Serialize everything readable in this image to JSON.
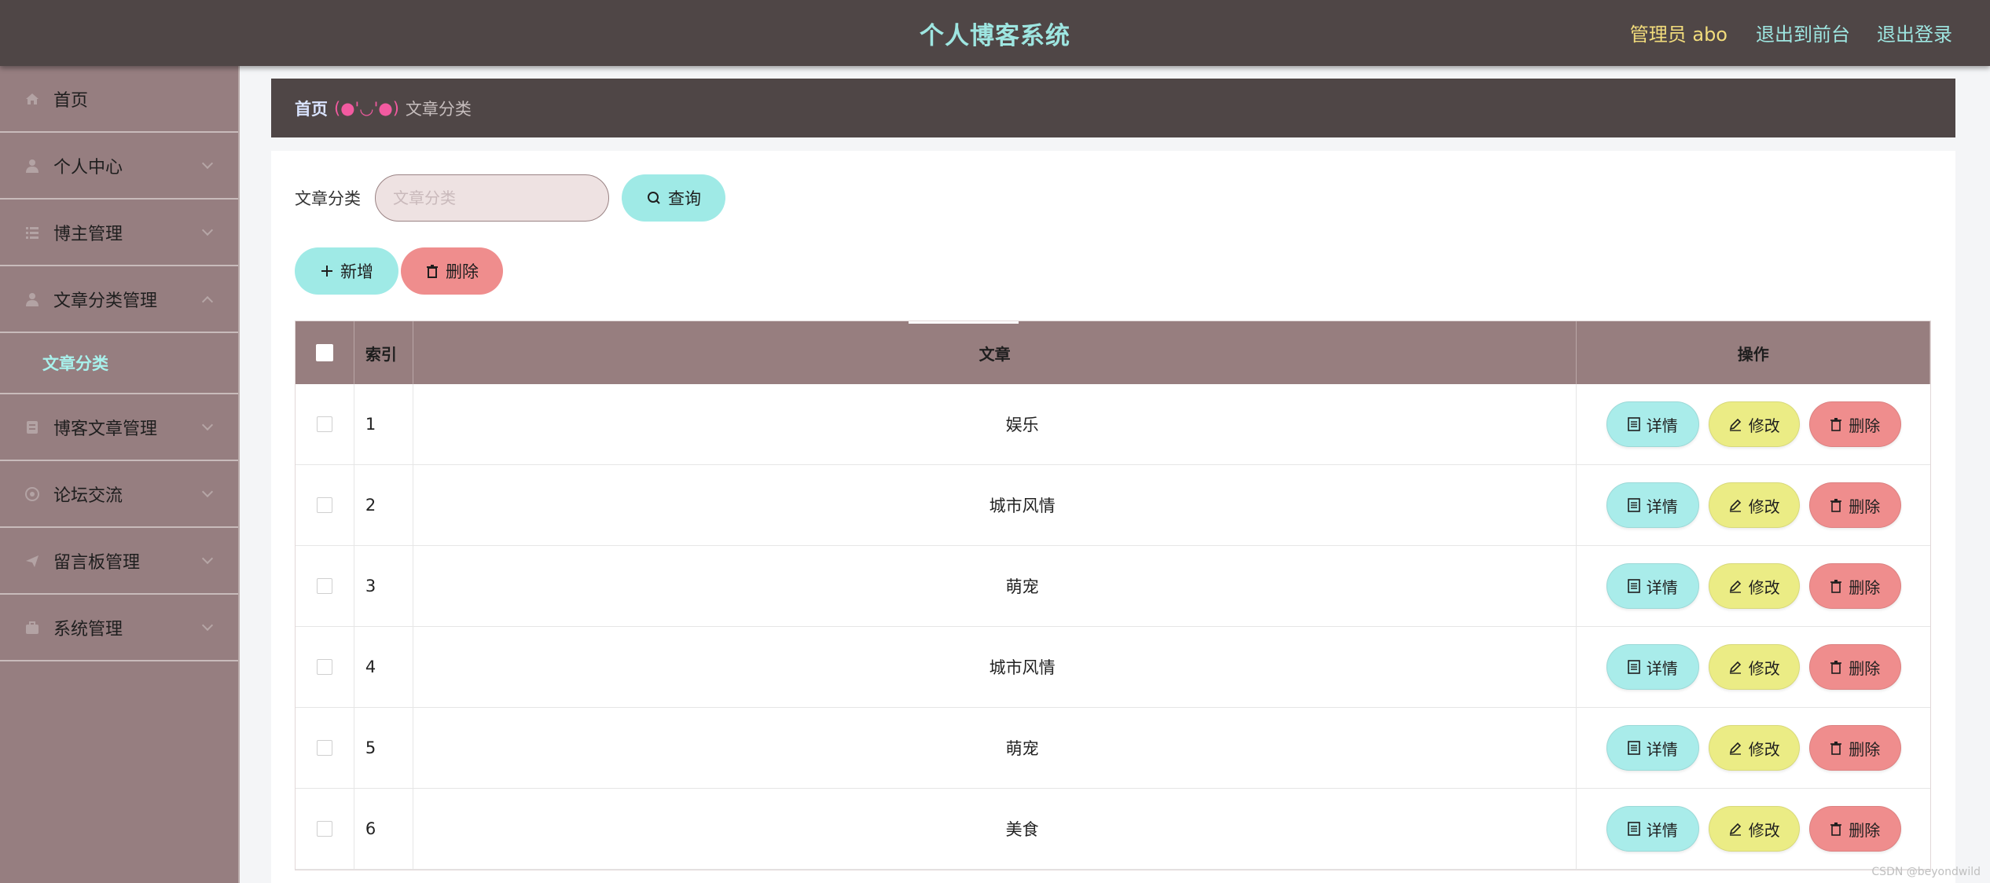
{
  "header": {
    "title": "个人博客系统",
    "admin_label": "管理员 abo",
    "front_link": "退出到前台",
    "logout_link": "退出登录"
  },
  "sidebar": {
    "items": [
      {
        "label": "首页",
        "icon": "home-icon"
      },
      {
        "label": "个人中心",
        "icon": "user-icon"
      },
      {
        "label": "博主管理",
        "icon": "list-icon"
      },
      {
        "label": "文章分类管理",
        "icon": "user-icon",
        "expanded": true
      },
      {
        "label": "博客文章管理",
        "icon": "document-icon"
      },
      {
        "label": "论坛交流",
        "icon": "chat-icon"
      },
      {
        "label": "留言板管理",
        "icon": "send-icon"
      },
      {
        "label": "系统管理",
        "icon": "briefcase-icon"
      }
    ],
    "sub_item": "文章分类"
  },
  "breadcrumb": {
    "home": "首页",
    "separator": "(●'◡'●)",
    "current": "文章分类"
  },
  "search": {
    "label": "文章分类",
    "placeholder": "文章分类",
    "button": "查询"
  },
  "actions": {
    "add": "新增",
    "delete": "删除"
  },
  "table": {
    "headers": {
      "index": "索引",
      "text": "文章",
      "ops": "操作"
    },
    "rows": [
      {
        "index": "1",
        "text": "娱乐"
      },
      {
        "index": "2",
        "text": "城市风情"
      },
      {
        "index": "3",
        "text": "萌宠"
      },
      {
        "index": "4",
        "text": "城市风情"
      },
      {
        "index": "5",
        "text": "萌宠"
      },
      {
        "index": "6",
        "text": "美食"
      }
    ],
    "ops": {
      "detail": "详情",
      "edit": "修改",
      "delete": "删除"
    }
  },
  "watermark": "CSDN @beyondwild",
  "colors": {
    "topbar": "#4f4646",
    "sidebar": "#967e80",
    "accent_cyan": "#9feae6",
    "accent_yellow": "#ebec85",
    "accent_red": "#ef8d8d",
    "table_head": "#977e7f"
  }
}
